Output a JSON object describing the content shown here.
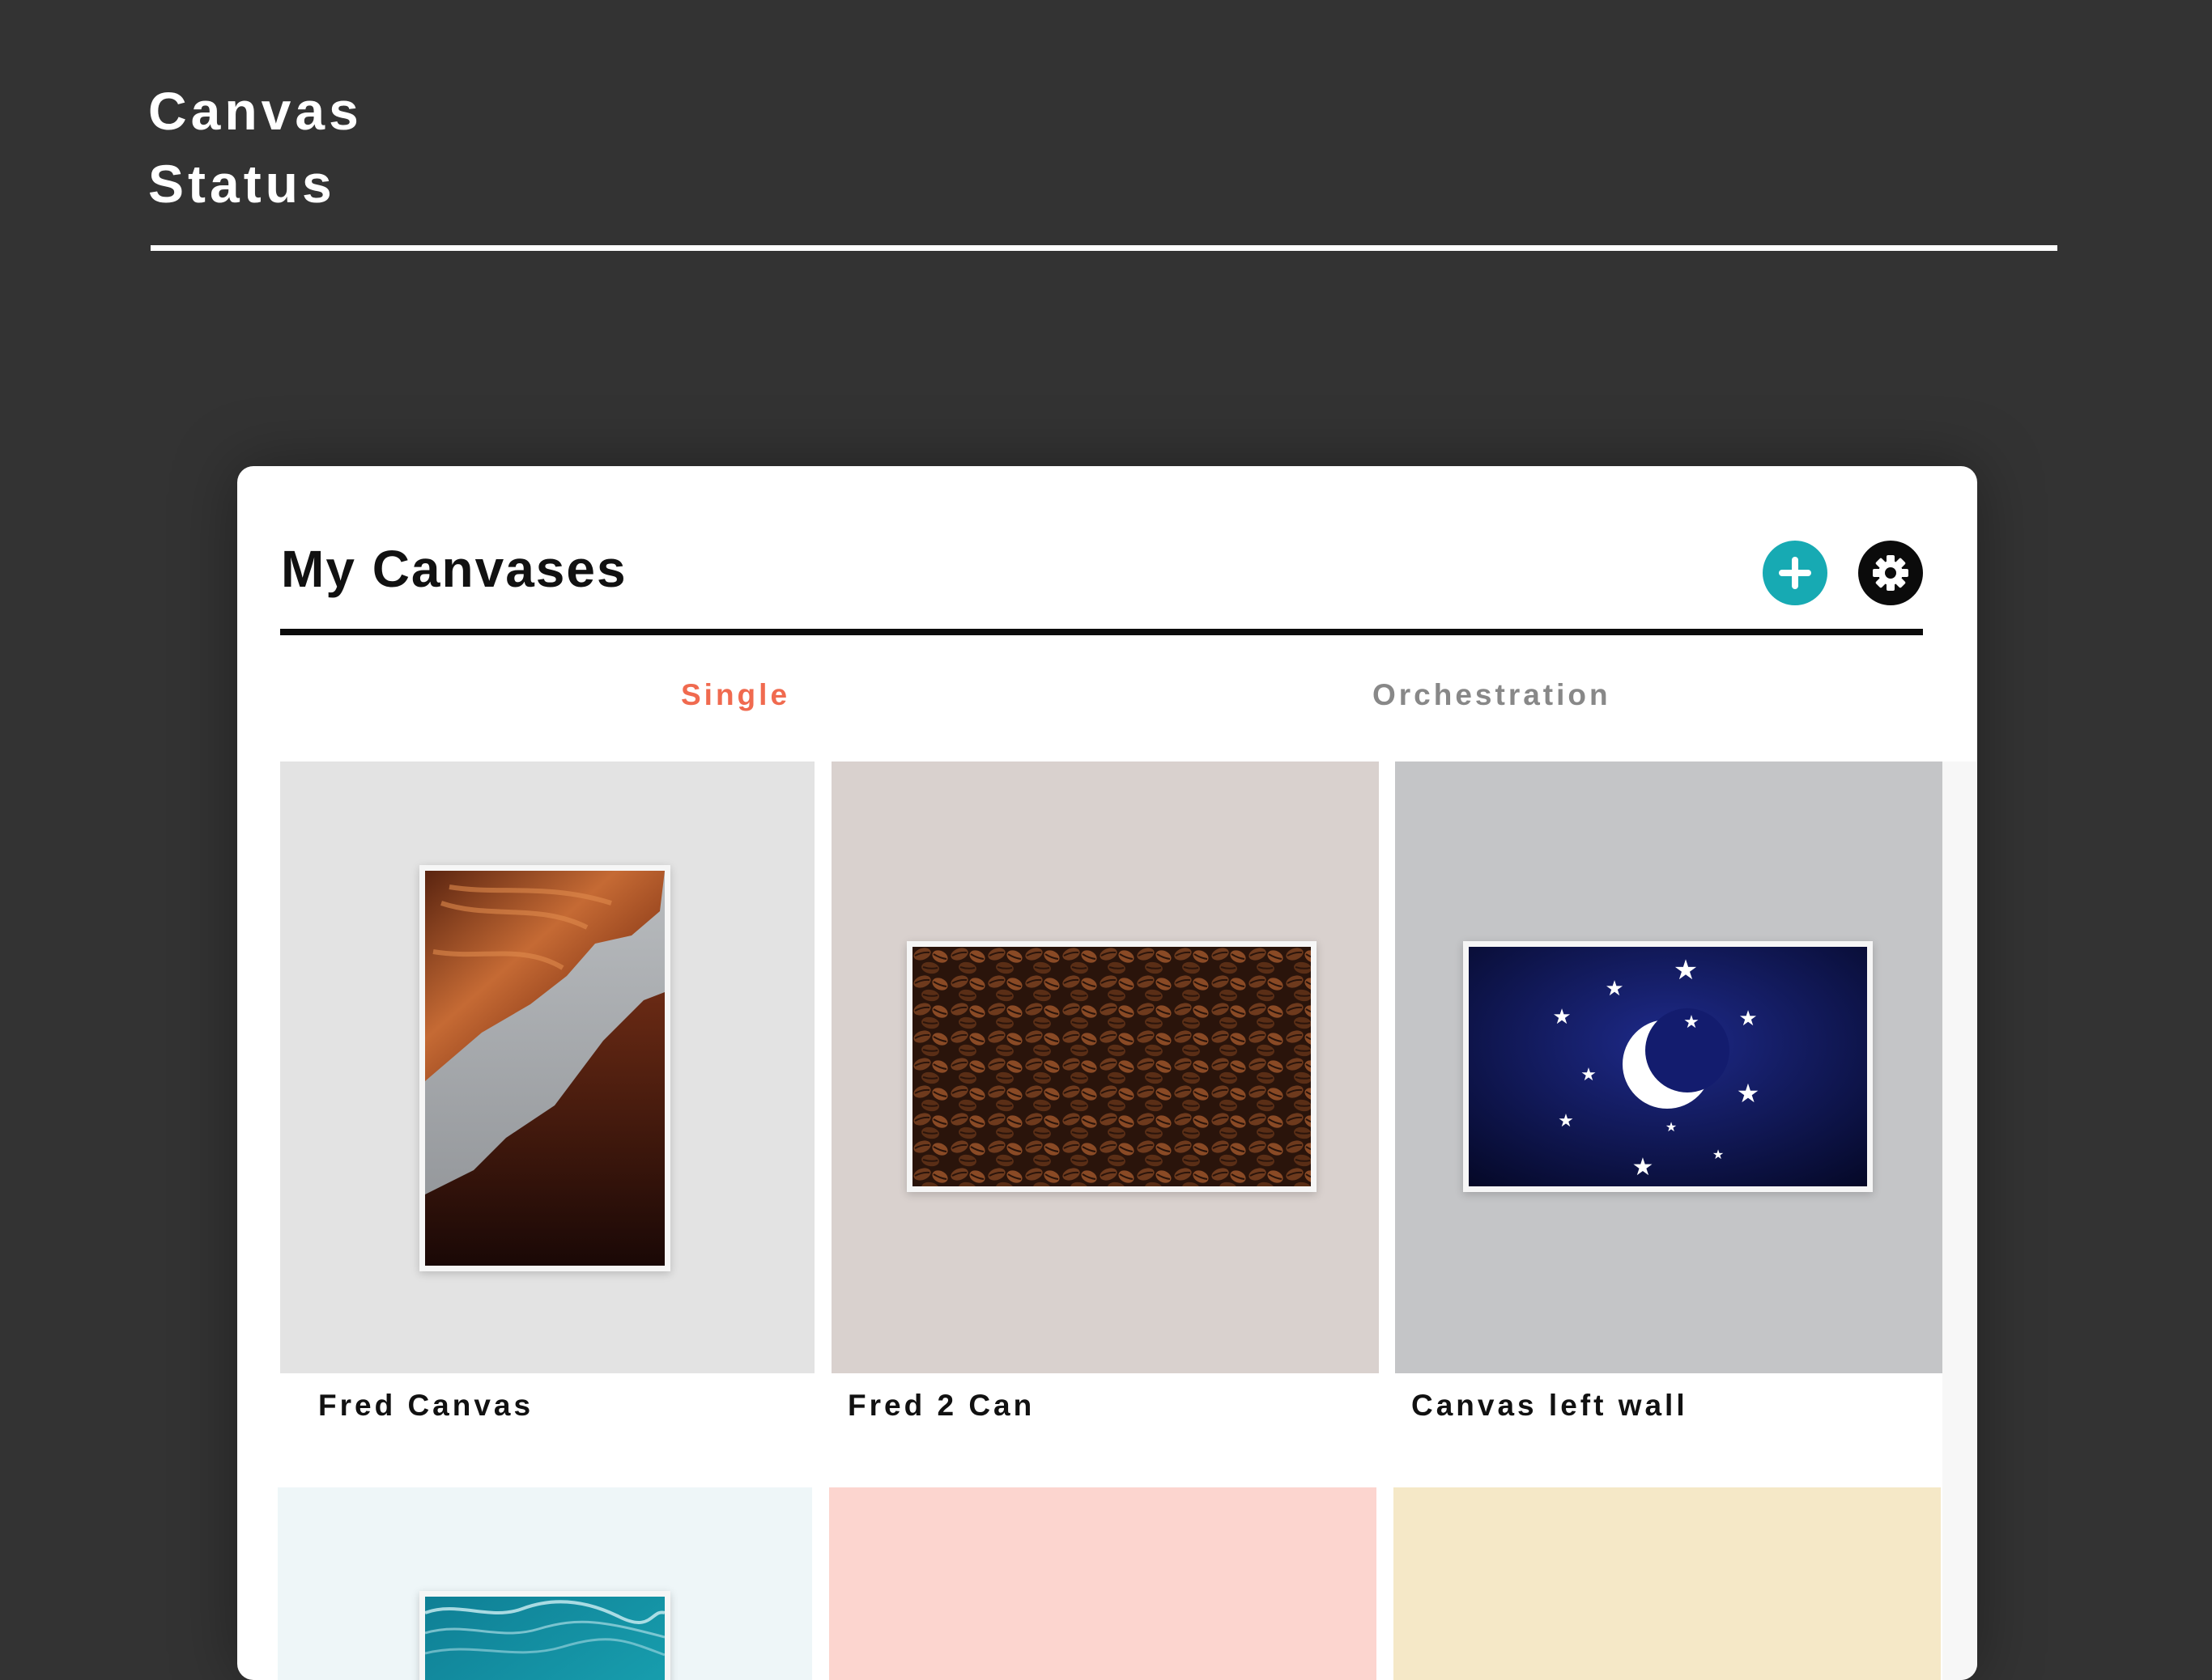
{
  "hero": {
    "title_line1": "Canvas",
    "title_line2": "Status"
  },
  "panel": {
    "title": "My Canvases",
    "add_icon": "plus-circle-icon",
    "settings_icon": "gear-icon",
    "accent_color": "#17aab3"
  },
  "tabs": [
    {
      "label": "Single",
      "active": true,
      "color": "#f06a4f"
    },
    {
      "label": "Orchestration",
      "active": false,
      "color": "#888888"
    }
  ],
  "canvases": [
    {
      "name": "Fred Canvas",
      "background": "#e3e3e3",
      "art": "antelope-canyon-photo",
      "orientation": "portrait"
    },
    {
      "name": "Fred 2 Can",
      "background": "#d9d1ce",
      "art": "coffee-beans-photo",
      "orientation": "landscape"
    },
    {
      "name": "Canvas left wall",
      "background": "#c4c5c7",
      "art": "night-sky-moon-stars",
      "orientation": "landscape"
    },
    {
      "name": "",
      "background": "#eef6f8",
      "art": "ocean-waves-photo",
      "orientation": "portrait"
    },
    {
      "name": "",
      "background": "#fcd5cf",
      "art": "",
      "orientation": ""
    },
    {
      "name": "",
      "background": "#f5e8c7",
      "art": "",
      "orientation": ""
    }
  ]
}
